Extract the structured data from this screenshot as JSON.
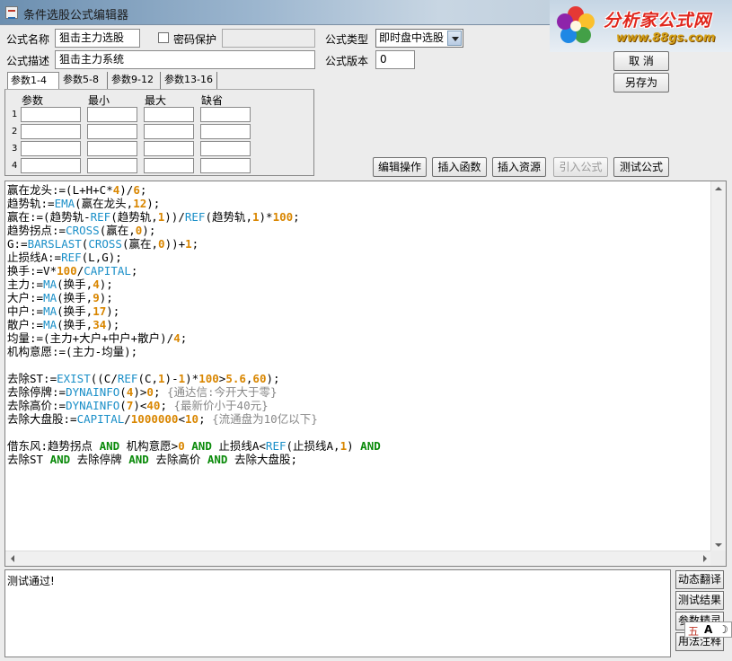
{
  "window": {
    "title": "条件选股公式编辑器"
  },
  "logo": {
    "title": "分析家公式网",
    "url": "www.88gs.com"
  },
  "form": {
    "name_label": "公式名称",
    "name_value": "狙击主力选股",
    "password_label": "密码保护",
    "type_label": "公式类型",
    "type_value": "即时盘中选股",
    "desc_label": "公式描述",
    "desc_value": "狙击主力系统",
    "version_label": "公式版本",
    "version_value": "0",
    "cancel_button": "取 消",
    "save_as_button": "另存为"
  },
  "params": {
    "tabs": [
      "参数1-4",
      "参数5-8",
      "参数9-12",
      "参数13-16"
    ],
    "columns": [
      "参数",
      "最小",
      "最大",
      "缺省"
    ],
    "rows": [
      "1",
      "2",
      "3",
      "4"
    ]
  },
  "toolbar": {
    "edit_ops": "编辑操作",
    "insert_func": "插入函数",
    "insert_res": "插入资源",
    "import_formula": "引入公式",
    "test_formula": "测试公式"
  },
  "code_lines": [
    "赢在龙头:=(L+H+C*4)/6;",
    "趋势轨:=EMA(赢在龙头,12);",
    "赢在:=(趋势轨-REF(趋势轨,1))/REF(趋势轨,1)*100;",
    "趋势拐点:=CROSS(赢在,0);",
    "G:=BARSLAST(CROSS(赢在,0))+1;",
    "止损线A:=REF(L,G);",
    "换手:=V*100/CAPITAL;",
    "主力:=MA(换手,4);",
    "大户:=MA(换手,9);",
    "中户:=MA(换手,17);",
    "散户:=MA(换手,34);",
    "均量:=(主力+大户+中户+散户)/4;",
    "机构意愿:=(主力-均量);",
    "",
    "去除ST:=EXIST((C/REF(C,1)-1)*100>5.6,60);",
    "去除停牌:=DYNAINFO(4)>0; {通达信:今开大于零}",
    "去除高价:=DYNAINFO(7)<40; {最新价小于40元}",
    "去除大盘股:=CAPITAL/1000000<10; {流通盘为10亿以下}",
    "",
    "借东风:趋势拐点 AND 机构意愿>0 AND 止损线A<REF(止损线A,1) AND",
    "去除ST AND 去除停牌 AND 去除高价 AND 去除大盘股;"
  ],
  "output": {
    "message": "测试通过!"
  },
  "side_buttons": [
    "动态翻译",
    "测试结果",
    "参数精灵",
    "用法注释"
  ],
  "ime": {
    "chars": [
      "五",
      "A",
      "☽"
    ]
  },
  "colors": {
    "function": "#1a8fc8",
    "keyword": "#0a8a0a",
    "number": "#d98600",
    "comment": "#888888"
  }
}
